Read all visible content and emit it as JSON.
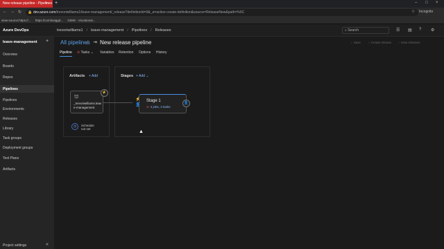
{
  "browser": {
    "tab_title": "New release pipeline - Pipelines",
    "tab_close": "×",
    "new_tab": "+",
    "window_controls": [
      "–",
      "□",
      "×"
    ],
    "url_host": "dev.azure.com",
    "url_path": "/trevoriwilliams1/leave-management/_release?definitionId=0&_a=action-create-definition&source=ReleaseNew&path=%5C",
    "incognito_label": "Incognito",
    "bookmarks": [
      "view-source:https://...",
      "https://comlsutggd...",
      "GIMS - Vocational..."
    ]
  },
  "header": {
    "brand": "Azure DevOps",
    "breadcrumbs": [
      "trevoriwilliams1",
      "leave-management",
      "Pipelines",
      "Releases"
    ],
    "search_placeholder": "Search"
  },
  "sidebar": {
    "project": "leave-management",
    "add": "+",
    "items": [
      {
        "label": "Overview"
      },
      {
        "label": "Boards"
      },
      {
        "label": "Repos"
      },
      {
        "label": "Pipelines"
      },
      {
        "label": "Pipelines"
      },
      {
        "label": "Environments"
      },
      {
        "label": "Releases"
      },
      {
        "label": "Library"
      },
      {
        "label": "Task groups"
      },
      {
        "label": "Deployment groups"
      },
      {
        "label": "Test Plans"
      },
      {
        "label": "Artifacts"
      }
    ],
    "project_settings": "Project settings",
    "collapse": "«"
  },
  "main": {
    "all_pipelines": "All pipelines",
    "sep": "/",
    "title": "New release pipeline",
    "actions": [
      "Save",
      "Create release",
      "View releases"
    ],
    "tabs": [
      "Pipeline",
      "Tasks",
      "Variables",
      "Retention",
      "Options",
      "History"
    ],
    "tasks_caret": "⌄",
    "artifacts": {
      "title": "Artifacts",
      "add": "+ Add",
      "artifact_name": "_trevoriwilliams.leave-management",
      "schedule_line1": "Schedule",
      "schedule_line2": "not set"
    },
    "stages": {
      "title": "Stages",
      "add": "+ Add",
      "stage_name": "Stage 1",
      "stage_status": "2 jobs, 3 tasks"
    }
  }
}
